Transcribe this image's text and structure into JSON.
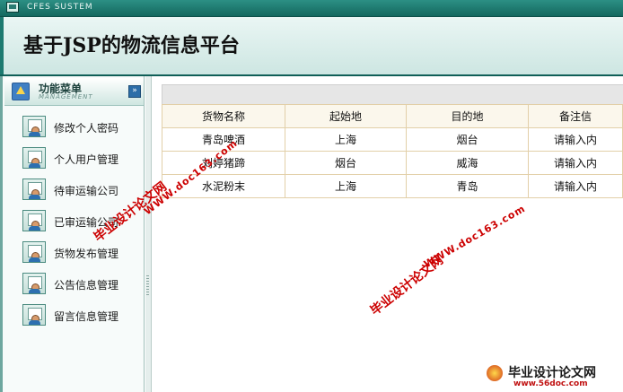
{
  "topbar": {
    "system_label": "CFES SUSTEM"
  },
  "header": {
    "title": "基于JSP的物流信息平台"
  },
  "sidebar": {
    "title": "功能菜单",
    "subtitle": "MANAGEMENT",
    "collapse_glyph": "»",
    "items": [
      {
        "label": "修改个人密码",
        "icon": "user-doc-icon"
      },
      {
        "label": "个人用户管理",
        "icon": "user-doc-icon"
      },
      {
        "label": "待审运输公司",
        "icon": "user-doc-icon"
      },
      {
        "label": "已审运输公司",
        "icon": "user-doc-icon"
      },
      {
        "label": "货物发布管理",
        "icon": "user-doc-icon"
      },
      {
        "label": "公告信息管理",
        "icon": "user-doc-icon"
      },
      {
        "label": "留言信息管理",
        "icon": "user-doc-icon"
      }
    ]
  },
  "table": {
    "columns": [
      "货物名称",
      "起始地",
      "目的地",
      "备注信"
    ],
    "rows": [
      [
        "青岛啤酒",
        "上海",
        "烟台",
        "请输入内"
      ],
      [
        "刘婷猪蹄",
        "烟台",
        "威海",
        "请输入内"
      ],
      [
        "水泥粉末",
        "上海",
        "青岛",
        "请输入内"
      ]
    ]
  },
  "watermarks": {
    "cn_text": "毕业设计论文网",
    "url_text": "WWW.doc163.com"
  },
  "footer_logo": {
    "text": "毕业设计论文网",
    "url": "www.56doc.com"
  },
  "colors": {
    "topbar": "#14685f",
    "header_border": "#0f5f57",
    "grid_border": "#e2cfa8",
    "watermark": "#cc0000"
  }
}
